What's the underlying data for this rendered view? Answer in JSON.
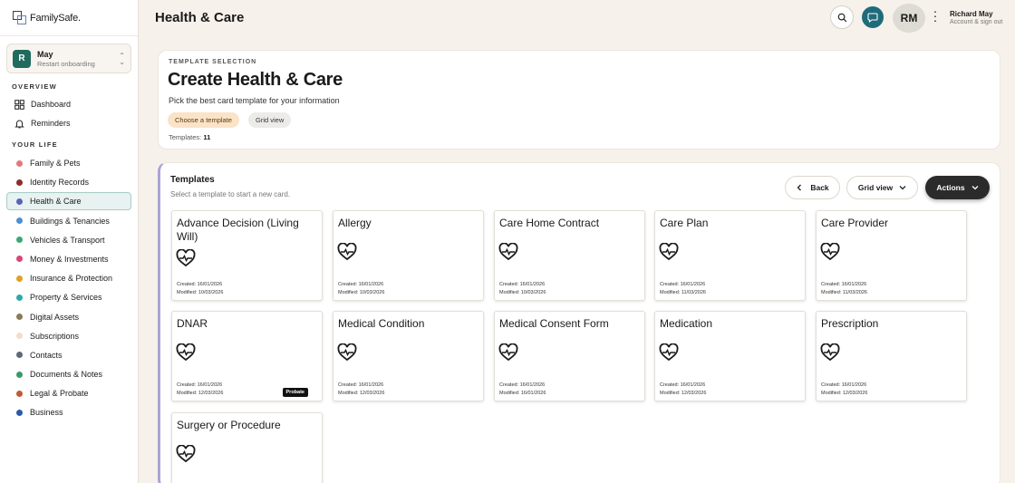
{
  "app": {
    "name": "FamilySafe."
  },
  "switcher": {
    "initial": "R",
    "name": "May",
    "sub": "Restart onboarding"
  },
  "sidebar": {
    "overview_label": "OVERVIEW",
    "overview_items": [
      {
        "label": "Dashboard",
        "icon": "dashboard-icon"
      },
      {
        "label": "Reminders",
        "icon": "bell-icon"
      }
    ],
    "your_life_label": "YOUR LIFE",
    "items": [
      {
        "label": "Family & Pets",
        "color": "#e07a7a"
      },
      {
        "label": "Identity Records",
        "color": "#8b2e2e"
      },
      {
        "label": "Health & Care",
        "color": "#5a63b8",
        "active": true
      },
      {
        "label": "Buildings & Tenancies",
        "color": "#4a90d9"
      },
      {
        "label": "Vehicles & Transport",
        "color": "#3aa876"
      },
      {
        "label": "Money & Investments",
        "color": "#d9467a"
      },
      {
        "label": "Insurance & Protection",
        "color": "#e0a020"
      },
      {
        "label": "Property & Services",
        "color": "#2ea8a8"
      },
      {
        "label": "Digital Assets",
        "color": "#8a7a5a"
      },
      {
        "label": "Subscriptions",
        "color": "#f2dcd0"
      },
      {
        "label": "Contacts",
        "color": "#5a6a7a"
      },
      {
        "label": "Documents & Notes",
        "color": "#3a9a6a"
      },
      {
        "label": "Legal & Probate",
        "color": "#c05a3a"
      },
      {
        "label": "Business",
        "color": "#2a5aa8"
      }
    ]
  },
  "topbar": {
    "title": "Health & Care",
    "avatar_initials": "RM",
    "user_name": "Richard May",
    "user_sub": "Account & sign out"
  },
  "header": {
    "eyebrow": "TEMPLATE SELECTION",
    "title": "Create Health & Care",
    "subtitle": "Pick the best card template for your information",
    "chip_choose": "Choose a template",
    "chip_grid": "Grid view",
    "count_label": "Templates:",
    "count_value": "11"
  },
  "templates": {
    "title": "Templates",
    "subtitle": "Select a template to start a new card.",
    "back_label": "Back",
    "grid_label": "Grid view",
    "actions_label": "Actions",
    "cards": [
      {
        "title": "Advance Decision (Living Will)",
        "created": "Created: 16/01/2026",
        "modified": "Modified: 10/03/2026"
      },
      {
        "title": "Allergy",
        "created": "Created: 16/01/2026",
        "modified": "Modified: 10/03/2026"
      },
      {
        "title": "Care Home Contract",
        "created": "Created: 16/01/2026",
        "modified": "Modified: 10/03/2026"
      },
      {
        "title": "Care Plan",
        "created": "Created: 16/01/2026",
        "modified": "Modified: 11/03/2026"
      },
      {
        "title": "Care Provider",
        "created": "Created: 16/01/2026",
        "modified": "Modified: 11/03/2026"
      },
      {
        "title": "DNAR",
        "created": "Created: 16/01/2026",
        "modified": "Modified: 12/03/2026",
        "badge": "Probate"
      },
      {
        "title": "Medical Condition",
        "created": "Created: 16/01/2026",
        "modified": "Modified: 12/03/2026"
      },
      {
        "title": "Medical Consent Form",
        "created": "Created: 16/01/2026",
        "modified": "Modified: 16/01/2026"
      },
      {
        "title": "Medication",
        "created": "Created: 16/01/2026",
        "modified": "Modified: 12/03/2026"
      },
      {
        "title": "Prescription",
        "created": "Created: 16/01/2026",
        "modified": "Modified: 12/03/2026"
      },
      {
        "title": "Surgery or Procedure",
        "created": "",
        "modified": ""
      }
    ]
  }
}
